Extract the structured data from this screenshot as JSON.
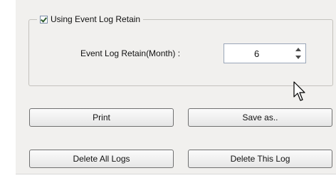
{
  "group": {
    "checkbox_label": "Using Event Log Retain",
    "checked": true
  },
  "retain": {
    "label": "Event Log Retain(Month) :",
    "value": "6"
  },
  "buttons": {
    "print": "Print",
    "save_as": "Save as..",
    "delete_all": "Delete All Logs",
    "delete_this": "Delete This Log"
  },
  "icons": [
    "checkbox-checked-icon",
    "spin-up-icon",
    "spin-down-icon",
    "mouse-cursor-icon"
  ]
}
